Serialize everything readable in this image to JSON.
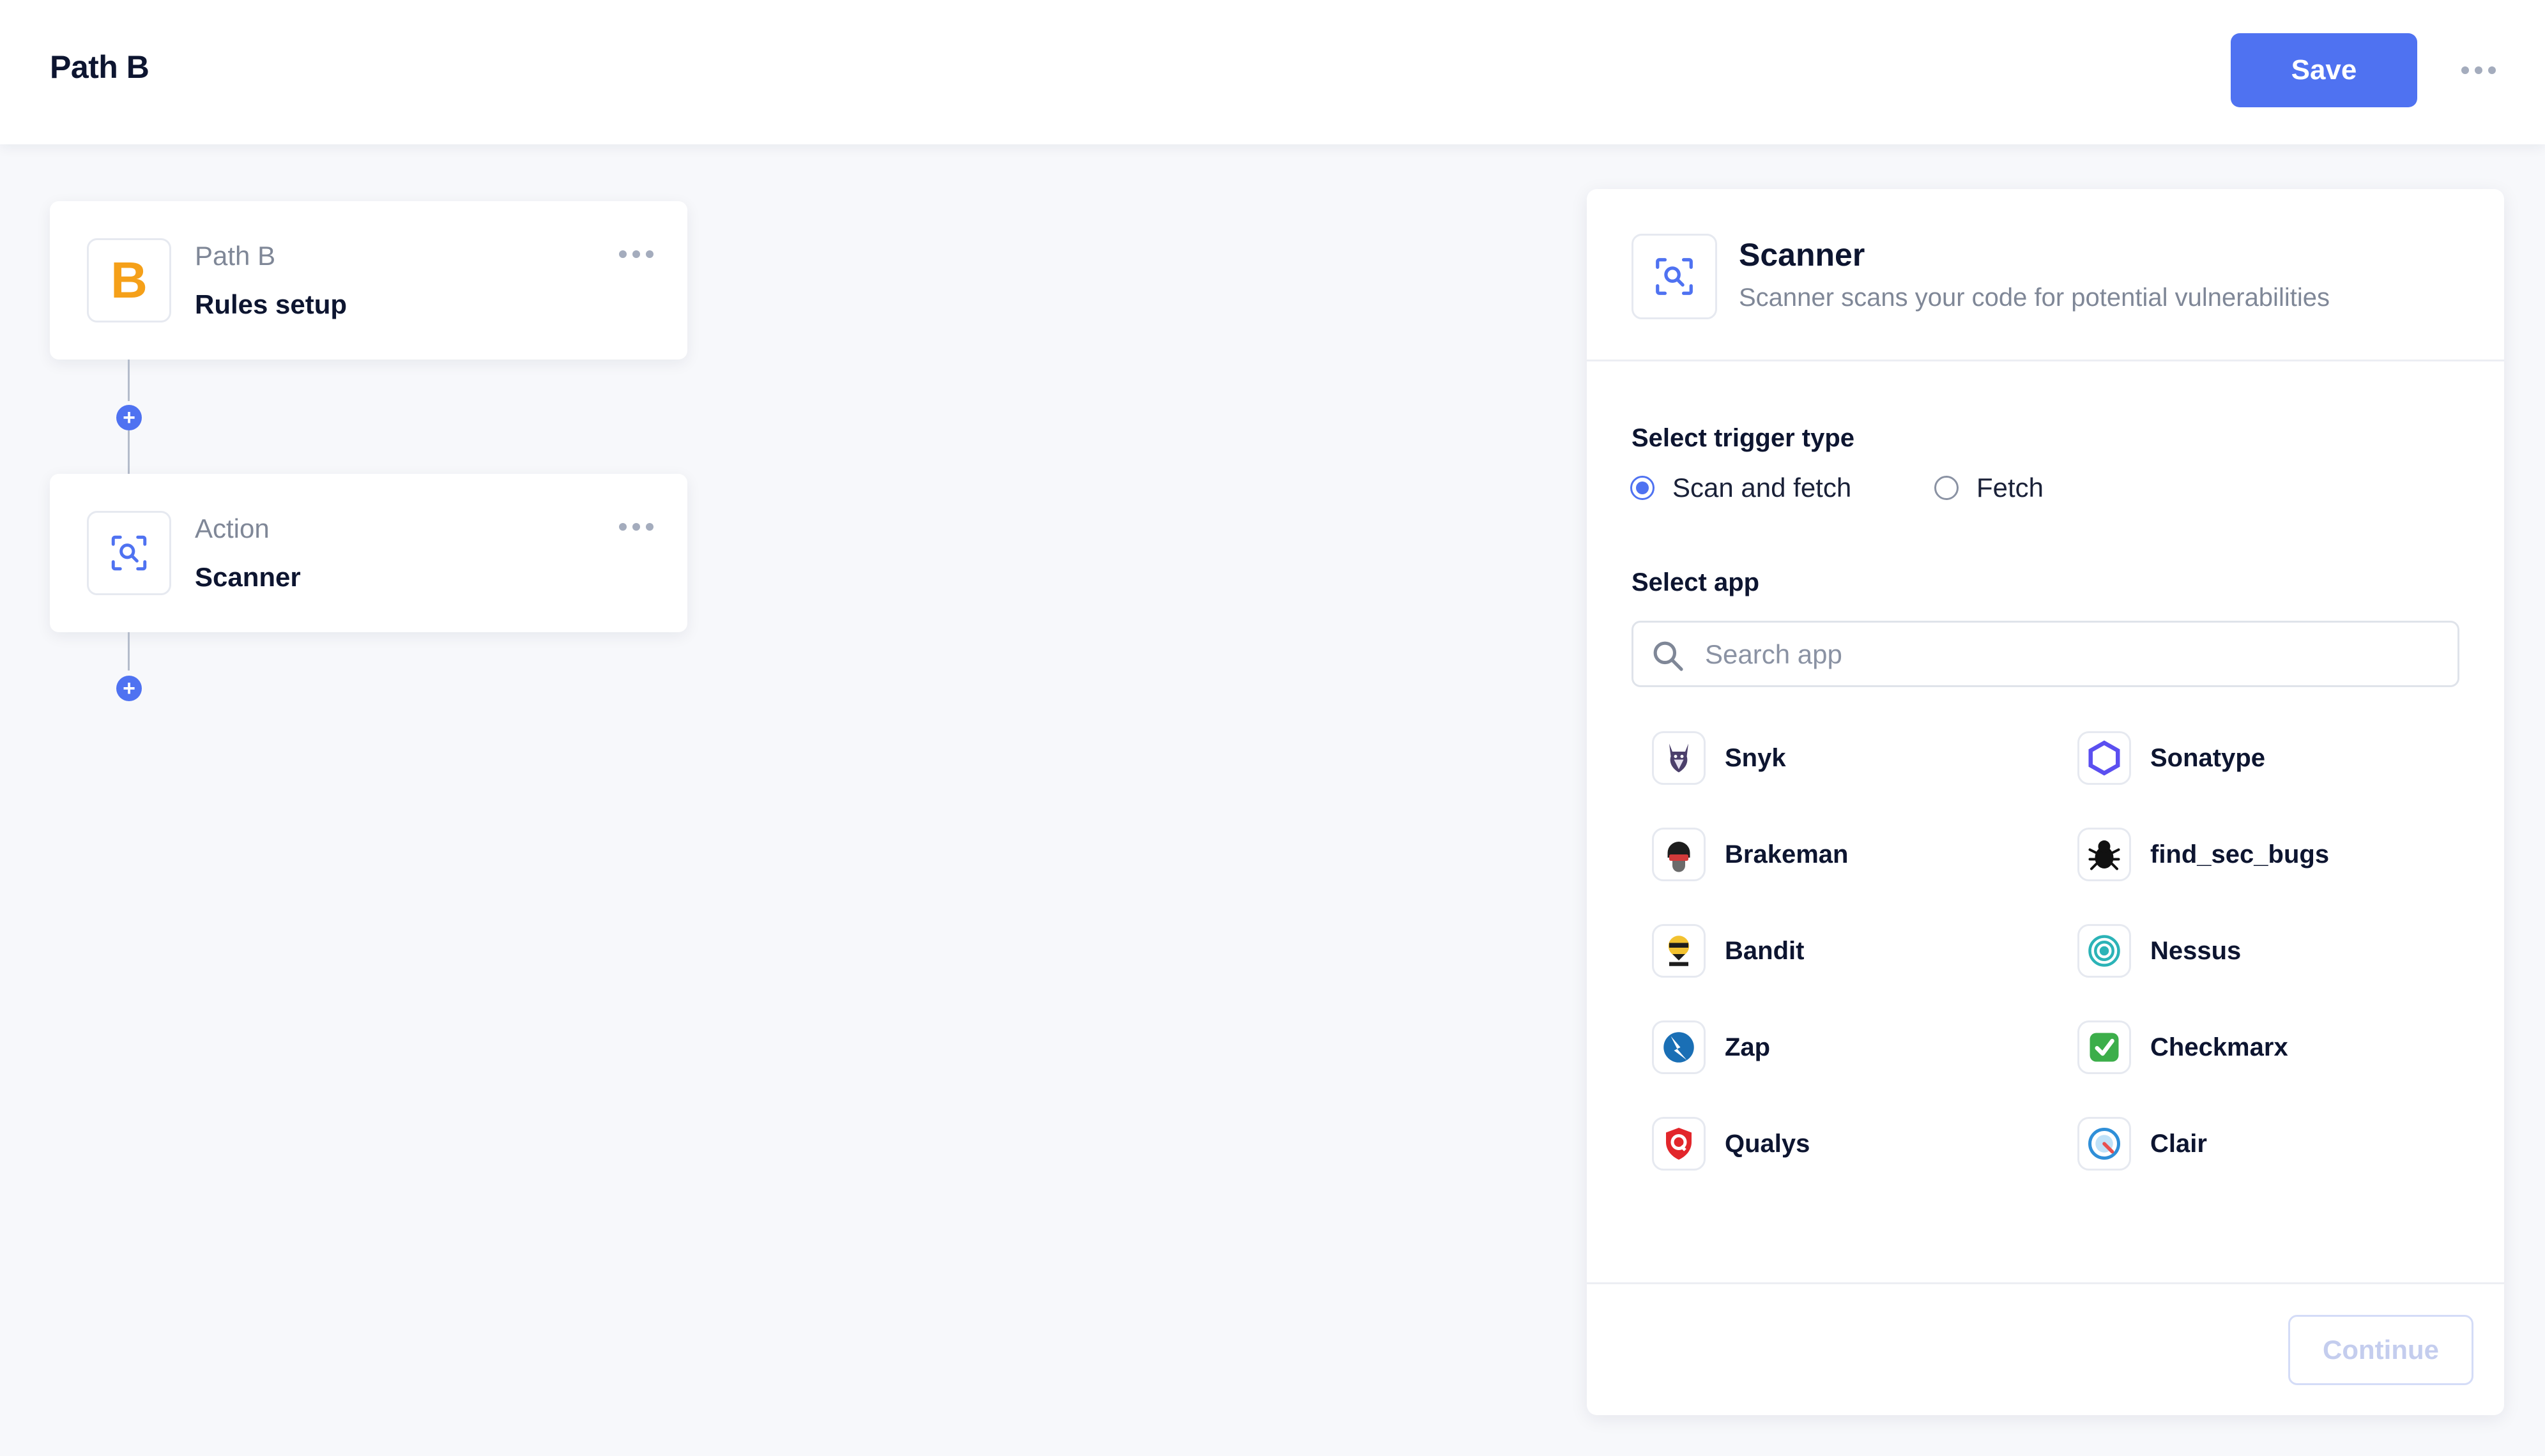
{
  "header": {
    "title": "Path B",
    "save_label": "Save"
  },
  "flow": {
    "nodes": [
      {
        "subtitle": "Path B",
        "title": "Rules setup",
        "icon_letter": "B",
        "icon": "letter-b-icon",
        "icon_color": "#f5a019"
      },
      {
        "subtitle": "Action",
        "title": "Scanner",
        "icon": "scanner-icon"
      }
    ],
    "add_symbol": "+"
  },
  "panel": {
    "title": "Scanner",
    "description": "Scanner scans your code for potential vulnerabilities",
    "trigger_label": "Select trigger type",
    "trigger_options": [
      {
        "label": "Scan and fetch",
        "selected": true
      },
      {
        "label": "Fetch",
        "selected": false
      }
    ],
    "app_label": "Select app",
    "search_placeholder": "Search app",
    "search_value": "",
    "apps": [
      {
        "name": "Snyk",
        "icon": "snyk-icon"
      },
      {
        "name": "Sonatype",
        "icon": "sonatype-icon"
      },
      {
        "name": "Brakeman",
        "icon": "brakeman-icon"
      },
      {
        "name": "find_sec_bugs",
        "icon": "find-sec-bugs-icon"
      },
      {
        "name": "Bandit",
        "icon": "bandit-icon"
      },
      {
        "name": "Nessus",
        "icon": "nessus-icon"
      },
      {
        "name": "Zap",
        "icon": "zap-icon"
      },
      {
        "name": "Checkmarx",
        "icon": "checkmarx-icon"
      },
      {
        "name": "Qualys",
        "icon": "qualys-icon"
      },
      {
        "name": "Clair",
        "icon": "clair-icon"
      }
    ],
    "continue_label": "Continue"
  },
  "colors": {
    "accent": "#4f72f1",
    "text": "#0d1530",
    "muted": "#7f8797",
    "background": "#f7f8fb"
  }
}
